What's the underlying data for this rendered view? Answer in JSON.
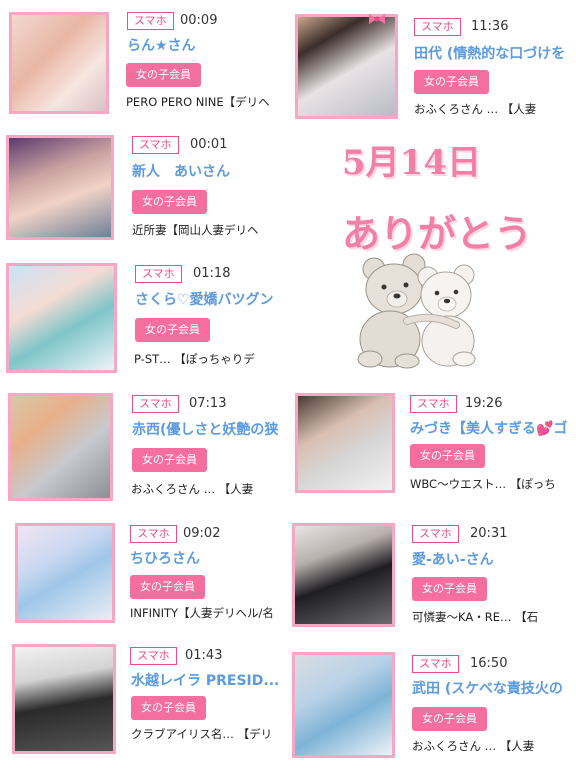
{
  "left_cards": [
    {
      "tag": "スマホ",
      "time": "00:09",
      "name": "らん★さん",
      "badge": "女の子会員",
      "shop": "PERO PERO NINE【デリヘ"
    },
    {
      "tag": "スマホ",
      "time": "00:01",
      "name": "新人　あいさん",
      "badge": "女の子会員",
      "shop": "近所妻【岡山人妻デリヘ"
    },
    {
      "tag": "スマホ",
      "time": "01:18",
      "name": "さくら♡愛嬌バツグン",
      "badge": "女の子会員",
      "shop": "P-ST… 【ぽっちゃりデ"
    },
    {
      "tag": "スマホ",
      "time": "07:13",
      "name": "赤西(優しさと妖艶の狭",
      "badge": "女の子会員",
      "shop": "おふくろさん … 【人妻"
    },
    {
      "tag": "スマホ",
      "time": "09:02",
      "name": "ちひろさん",
      "badge": "女の子会員",
      "shop": "INFINITY【人妻デリヘル/名"
    },
    {
      "tag": "スマホ",
      "time": "01:43",
      "name": "水越レイラ PRESID...",
      "badge": "女の子会員",
      "shop": "クラブアイリス名… 【デリ"
    }
  ],
  "right_cards": [
    {
      "tag": "スマホ",
      "time": "11:36",
      "name": "田代 (情熱的な口づけを",
      "badge": "女の子会員",
      "shop": "おふくろさん … 【人妻"
    },
    {
      "tag": "スマホ",
      "time": "19:26",
      "name": "みづき【美人すぎる💕ゴ",
      "badge": "女の子会員",
      "shop": "WBC〜ウエスト… 【ぽっち"
    },
    {
      "tag": "スマホ",
      "time": "20:31",
      "name": "愛-あい-さん",
      "badge": "女の子会員",
      "shop": "可憐妻〜KA・RE… 【石"
    },
    {
      "tag": "スマホ",
      "time": "16:50",
      "name": "武田 (スケベな責技火の",
      "badge": "女の子会員",
      "shop": "おふくろさん … 【人妻"
    }
  ],
  "decoration": {
    "date_text": "5月14日",
    "thanks_text": "ありがとう",
    "image": "teddy-bears-hugging"
  },
  "colors": {
    "accent_pink": "#f56f9e",
    "border_pink": "#f7a7c3",
    "name_blue": "#5c9be0"
  }
}
